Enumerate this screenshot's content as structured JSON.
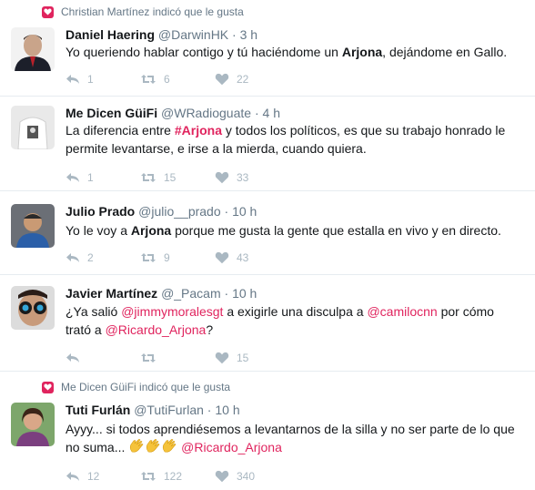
{
  "colors": {
    "accent": "#e0245e",
    "muted": "#657786",
    "icon": "#aab8c2",
    "divider": "#e6ecf0"
  },
  "tweets": [
    {
      "context": "Christian Martínez indicó que le gusta",
      "name": "Daniel Haering",
      "handle": "@DarwinHK",
      "dot": "·",
      "time": "3 h",
      "text": {
        "p1": "Yo queriendo hablar contigo y tú haciéndome un ",
        "b1": "Arjona",
        ", dejándome en Gallo.": "",
        "p2": ", dejándome en Gallo."
      },
      "replies": "1",
      "retweets": "6",
      "likes": "22"
    },
    {
      "name": "Me Dicen GüiFi",
      "handle": "@WRadioguate",
      "dot": "·",
      "time": "4 h",
      "text": {
        "p1": "La diferencia entre ",
        "l1": "#Arjona",
        "p2": " y todos los políticos, es que su trabajo honrado le permite levantarse, e irse a la mierda, cuando quiera."
      },
      "replies": "1",
      "retweets": "15",
      "likes": "33"
    },
    {
      "name": "Julio Prado",
      "handle": "@julio__prado",
      "dot": "·",
      "time": "10 h",
      "text": {
        "p1": "Yo le voy a ",
        "b1": "Arjona",
        "p2": " porque me gusta la gente que estalla en vivo y en directo."
      },
      "replies": "2",
      "retweets": "9",
      "likes": "43"
    },
    {
      "name": "Javier Martínez",
      "handle": "@_Pacam",
      "dot": "·",
      "time": "10 h",
      "text": {
        "p1": "¿Ya salió ",
        "l1": "@jimmymoralesgt",
        "p2": " a exigirle una disculpa a ",
        "l2": "@camilocnn",
        "p3": " por cómo trató a ",
        "l3": "@Ricardo_Arjona",
        "p4": "?"
      },
      "replies": "",
      "retweets": "",
      "likes": "15"
    },
    {
      "context": "Me Dicen GüiFi indicó que le gusta",
      "name": "Tuti Furlán",
      "handle": "@TutiFurlan",
      "dot": "·",
      "time": "10 h",
      "text": {
        "p1": "Ayyy... si todos aprendiésemos a levantarnos de la silla y no ser parte de lo que no suma... ",
        "l1": "@Ricardo_Arjona"
      },
      "replies": "12",
      "retweets": "122",
      "likes": "340"
    }
  ]
}
